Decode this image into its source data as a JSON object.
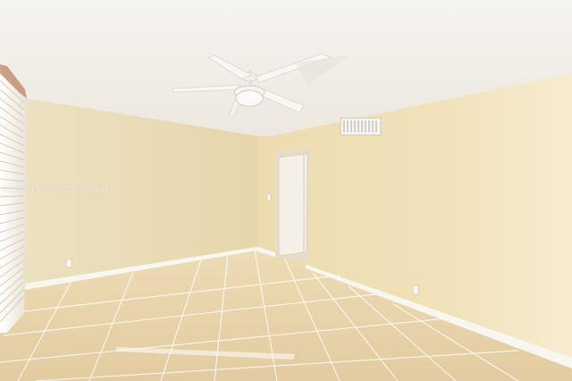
{
  "watermark": "A11708816 © Miami MLS® 2024",
  "scene": {
    "ceiling_fan_icon": "ceiling-fan-icon",
    "colors": {
      "ceiling": "#f4f2ec",
      "wall_left": "#eadcb4",
      "wall_right": "#f0e1ba",
      "floor_tile": "#e4cfa7",
      "baseboard": "#f8f6f1",
      "door": "#f3efe6"
    }
  }
}
